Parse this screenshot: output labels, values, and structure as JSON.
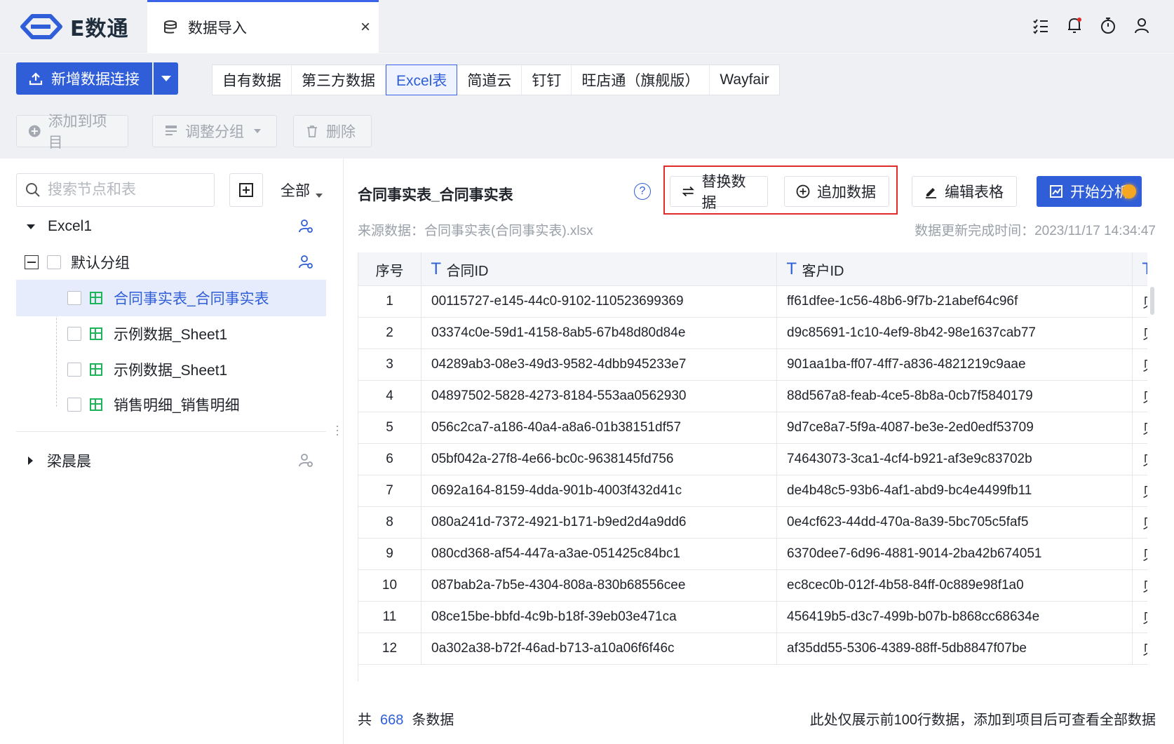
{
  "app": {
    "logo_text": "E数通"
  },
  "tab": {
    "label": "数据导入",
    "close": "×"
  },
  "toolbar": {
    "new_connection": "新增数据连接",
    "source_tabs": [
      "自有数据",
      "第三方数据",
      "Excel表",
      "简道云",
      "钉钉",
      "旺店通（旗舰版）",
      "Wayfair"
    ],
    "active_source": "Excel表",
    "add_to_project": "添加到项目",
    "adjust_group": "调整分组",
    "delete": "删除"
  },
  "sidebar": {
    "search_placeholder": "搜索节点和表",
    "filter": "全部",
    "tree": [
      {
        "label": "Excel1",
        "level": 0,
        "expanded": true
      },
      {
        "label": "默认分组",
        "level": 1,
        "expanded": true
      },
      {
        "label": "合同事实表_合同事实表",
        "level": 2,
        "selected": true
      },
      {
        "label": "示例数据_Sheet1",
        "level": 2
      },
      {
        "label": "示例数据_Sheet1",
        "level": 2
      },
      {
        "label": "销售明细_销售明细",
        "level": 2
      },
      {
        "label": "梁晨晨",
        "level": 0,
        "expanded": false
      }
    ]
  },
  "main": {
    "title": "合同事实表_合同事实表",
    "help": "?",
    "replace_data": "替换数据",
    "append_data": "追加数据",
    "edit_table": "编辑表格",
    "start_analysis": "开始分析",
    "source": "来源数据：合同事实表(合同事实表).xlsx",
    "updated": "数据更新完成时间：2023/11/17 14:34:47"
  },
  "table": {
    "headers": [
      "序号",
      "合同ID",
      "客户ID",
      ""
    ],
    "type_icon": "T",
    "rows": [
      [
        "1",
        "00115727-e145-44c0-9102-110523699369",
        "ff61dfee-1c56-48b6-9f7b-21abef64c96f",
        "贝"
      ],
      [
        "2",
        "03374c0e-59d1-4158-8ab5-67b48d80d84e",
        "d9c85691-1c10-4ef9-8b42-98e1637cab77",
        "贝"
      ],
      [
        "3",
        "04289ab3-08e3-49d3-9582-4dbb945233e7",
        "901aa1ba-ff07-4ff7-a836-4821219c9aae",
        "贝"
      ],
      [
        "4",
        "04897502-5828-4273-8184-553aa0562930",
        "88d567a8-feab-4ce5-8b8a-0cb7f5840179",
        "贝"
      ],
      [
        "5",
        "056c2ca7-a186-40a4-a8a6-01b38151df57",
        "9d7ce8a7-5f9a-4087-be3e-2ed0edf53709",
        "贝"
      ],
      [
        "6",
        "05bf042a-27f8-4e66-bc0c-9638145fd756",
        "74643073-3ca1-4cf4-b921-af3e9c83702b",
        "贝"
      ],
      [
        "7",
        "0692a164-8159-4dda-901b-4003f432d41c",
        "de4b48c5-93b6-4af1-abd9-bc4e4499fb11",
        "贝"
      ],
      [
        "8",
        "080a241d-7372-4921-b171-b9ed2d4a9dd6",
        "0e4cf623-44dd-470a-8a39-5bc705c5faf5",
        "贝"
      ],
      [
        "9",
        "080cd368-af54-447a-a3ae-051425c84bc1",
        "6370dee7-6d96-4881-9014-2ba42b674051",
        "贝"
      ],
      [
        "10",
        "087bab2a-7b5e-4304-808a-830b68556cee",
        "ec8cec0b-012f-4b58-84ff-0c889e98f1a0",
        "贝"
      ],
      [
        "11",
        "08ce15be-bbfd-4c9b-b18f-39eb03e471ca",
        "456419b5-d3c7-499b-b07b-b868cc68634e",
        "贝"
      ],
      [
        "12",
        "0a302a38-b72f-46ad-b713-a10a06f6f46c",
        "af35dd55-5306-4389-88ff-5db8847f07be",
        "贝"
      ]
    ]
  },
  "footer": {
    "prefix": "共",
    "count": "668",
    "suffix": "条数据",
    "note": "此处仅展示前100行数据，添加到项目后可查看全部数据"
  },
  "colors": {
    "primary": "#2f5ed8",
    "highlight": "#e02b2b",
    "sheet_icon": "#1eb45a"
  }
}
